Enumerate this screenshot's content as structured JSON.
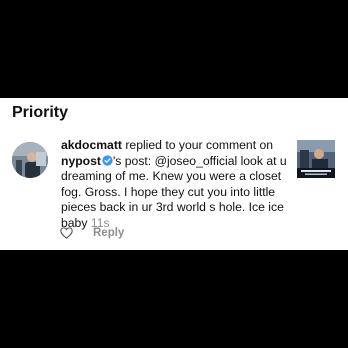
{
  "section": {
    "title": "Priority"
  },
  "notification": {
    "username": "akdocmatt",
    "action_text": " replied to your comment on ",
    "account": "nypost",
    "post_suffix": "'s post: ",
    "comment_text": "@joseo_official look at u dreaming of me. Knew you were a closet fog.  Gross.  I hope they cut you into little pieces back in ur 3rd world s hole.  Ice ice baby",
    "timestamp": " 11s",
    "avatar_icon": "user-avatar-photo",
    "verified_icon": "verified-badge-icon",
    "verified_color": "#3897f0",
    "thumbnail_icon": "post-thumbnail-photo"
  },
  "actions": {
    "like_icon": "heart-outline-icon",
    "reply_label": "Reply"
  }
}
